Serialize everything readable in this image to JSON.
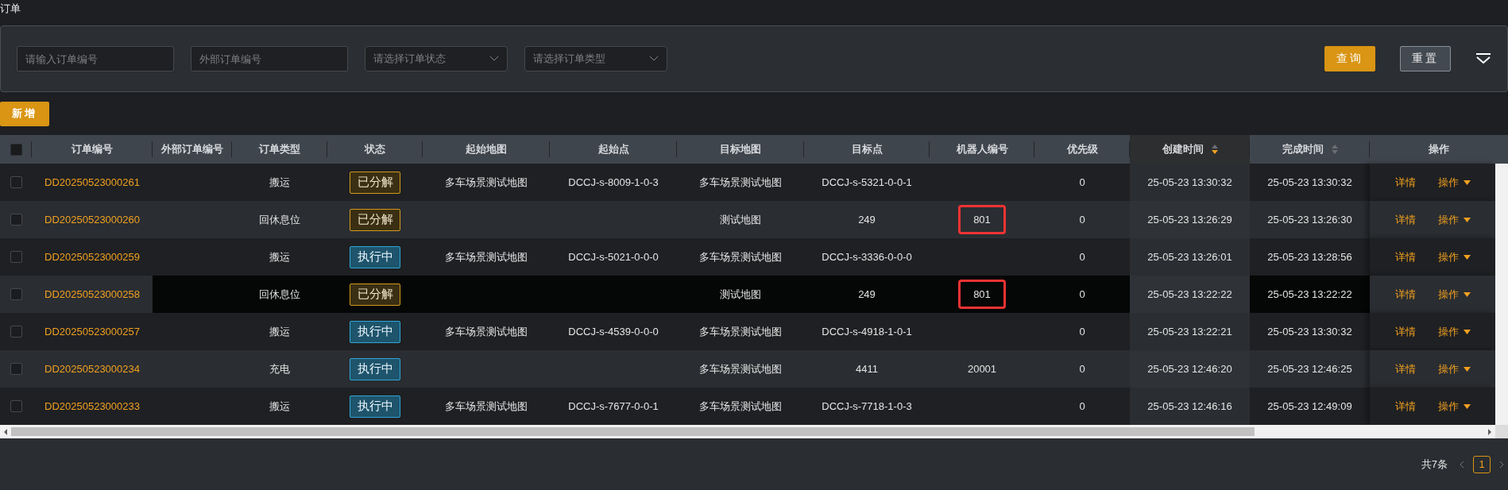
{
  "page_title": "订单",
  "filters": {
    "fields": [
      {
        "kind": "input",
        "placeholder": "请输入订单编号"
      },
      {
        "kind": "input",
        "placeholder": "外部订单编号"
      },
      {
        "kind": "select",
        "placeholder": "请选择订单状态"
      },
      {
        "kind": "select",
        "placeholder": "请选择订单类型"
      }
    ],
    "buttons": [
      {
        "label": "查询",
        "kind": "primary"
      },
      {
        "label": "重置",
        "kind": "secondary"
      }
    ]
  },
  "add_button": "新增",
  "table": {
    "select_all_checked": false,
    "columns": [
      {
        "label": "订单编号"
      },
      {
        "label": "外部订单编号"
      },
      {
        "label": "订单类型"
      },
      {
        "label": "状态"
      },
      {
        "label": "起始地图"
      },
      {
        "label": "起始点"
      },
      {
        "label": "目标地图"
      },
      {
        "label": "目标点"
      },
      {
        "label": "机器人编号"
      },
      {
        "label": "优先级"
      },
      {
        "label": "创建时间",
        "sortable": true,
        "sorted": true
      },
      {
        "label": "完成时间",
        "sortable": true,
        "sorted": false
      },
      {
        "label": "操作"
      }
    ],
    "rows": [
      {
        "checked": false,
        "hovered": false,
        "order_no": "DD20250523000261",
        "order_type": "搬运",
        "status": {
          "label": "已分解",
          "kind": "decomposed"
        },
        "start_map": "多车场景测试地图",
        "start_point": "DCCJ-s-8009-1-0-3",
        "target_map": "多车场景测试地图",
        "target_point": "DCCJ-s-5321-0-0-1",
        "robot": "",
        "robot_marked": false,
        "priority": "0",
        "created": "25-05-23 13:30:32",
        "finished": "25-05-23 13:30:32",
        "detail": "详情",
        "action": "操作"
      },
      {
        "checked": false,
        "hovered": false,
        "order_no": "DD20250523000260",
        "order_type": "回休息位",
        "status": {
          "label": "已分解",
          "kind": "decomposed"
        },
        "start_map": "",
        "start_point": "",
        "target_map": "测试地图",
        "target_point": "249",
        "robot": "801",
        "robot_marked": true,
        "priority": "0",
        "created": "25-05-23 13:26:29",
        "finished": "25-05-23 13:26:30",
        "detail": "详情",
        "action": "操作"
      },
      {
        "checked": false,
        "hovered": false,
        "order_no": "DD20250523000259",
        "order_type": "搬运",
        "status": {
          "label": "执行中",
          "kind": "running"
        },
        "start_map": "多车场景测试地图",
        "start_point": "DCCJ-s-5021-0-0-0",
        "target_map": "多车场景测试地图",
        "target_point": "DCCJ-s-3336-0-0-0",
        "robot": "",
        "robot_marked": false,
        "priority": "0",
        "created": "25-05-23 13:26:01",
        "finished": "25-05-23 13:28:56",
        "detail": "详情",
        "action": "操作"
      },
      {
        "checked": false,
        "hovered": true,
        "order_no": "DD20250523000258",
        "order_type": "回休息位",
        "status": {
          "label": "已分解",
          "kind": "decomposed"
        },
        "start_map": "",
        "start_point": "",
        "target_map": "测试地图",
        "target_point": "249",
        "robot": "801",
        "robot_marked": true,
        "priority": "0",
        "created": "25-05-23 13:22:22",
        "finished": "25-05-23 13:22:22",
        "detail": "详情",
        "action": "操作"
      },
      {
        "checked": false,
        "hovered": false,
        "order_no": "DD20250523000257",
        "order_type": "搬运",
        "status": {
          "label": "执行中",
          "kind": "running"
        },
        "start_map": "多车场景测试地图",
        "start_point": "DCCJ-s-4539-0-0-0",
        "target_map": "多车场景测试地图",
        "target_point": "DCCJ-s-4918-1-0-1",
        "robot": "",
        "robot_marked": false,
        "priority": "0",
        "created": "25-05-23 13:22:21",
        "finished": "25-05-23 13:30:32",
        "detail": "详情",
        "action": "操作"
      },
      {
        "checked": false,
        "hovered": false,
        "order_no": "DD20250523000234",
        "order_type": "充电",
        "status": {
          "label": "执行中",
          "kind": "running"
        },
        "start_map": "",
        "start_point": "",
        "target_map": "多车场景测试地图",
        "target_point": "4411",
        "robot": "20001",
        "robot_marked": false,
        "priority": "0",
        "created": "25-05-23 12:46:20",
        "finished": "25-05-23 12:46:25",
        "detail": "详情",
        "action": "操作"
      },
      {
        "checked": false,
        "hovered": false,
        "order_no": "DD20250523000233",
        "order_type": "搬运",
        "status": {
          "label": "执行中",
          "kind": "running"
        },
        "start_map": "多车场景测试地图",
        "start_point": "DCCJ-s-7677-0-0-1",
        "target_map": "多车场景测试地图",
        "target_point": "DCCJ-s-7718-1-0-3",
        "robot": "",
        "robot_marked": false,
        "priority": "0",
        "created": "25-05-23 12:46:16",
        "finished": "25-05-23 12:49:09",
        "detail": "详情",
        "action": "操作"
      }
    ]
  },
  "pagination": {
    "total": "共7条",
    "pages": [
      {
        "label": "1",
        "selected": true
      }
    ]
  }
}
